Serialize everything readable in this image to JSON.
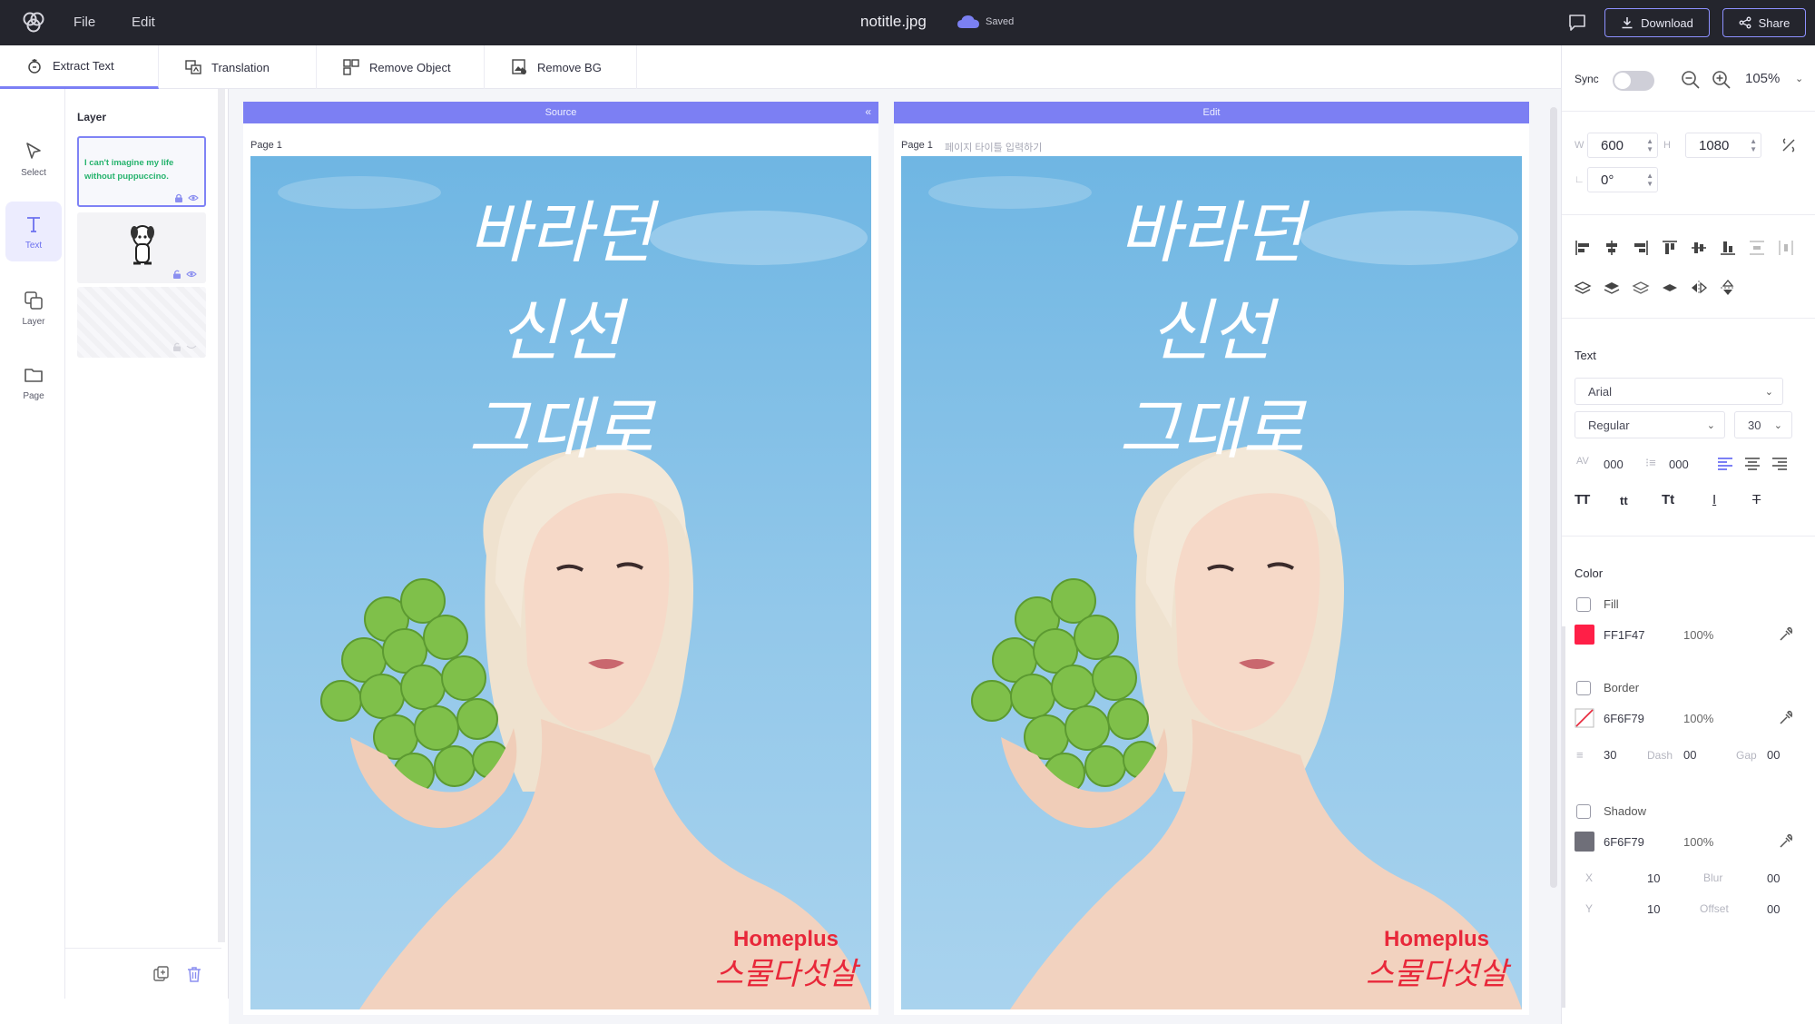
{
  "topbar": {
    "menu": [
      "File",
      "Edit"
    ],
    "file_name": "notitle.jpg",
    "save_status": "Saved",
    "download_label": "Download",
    "share_label": "Share"
  },
  "tools": {
    "tabs": [
      "Extract Text",
      "Translation",
      "Remove Object",
      "Remove BG"
    ]
  },
  "rail": {
    "items": [
      "Select",
      "Text",
      "Layer",
      "Page"
    ]
  },
  "layer_panel": {
    "title": "Layer",
    "layers": [
      {
        "text": "I can't imagine my life without puppuccino."
      }
    ]
  },
  "canvas": {
    "source_header": "Source",
    "edit_header": "Edit",
    "source_page_label": "Page 1",
    "edit_page_label": "Page 1",
    "edit_page_title_placeholder": "페이지 타이틀 입력하기",
    "poster": {
      "headline_lines": [
        "바라던",
        "신선",
        "그대로"
      ],
      "brand": "Homeplus",
      "brand_sub": "스물다섯살"
    }
  },
  "props": {
    "sync_label": "Sync",
    "sync_on": false,
    "zoom": "105%",
    "width_label": "W",
    "width": "600",
    "height_label": "H",
    "height": "1080",
    "rotation": "0°",
    "text_section": "Text",
    "font_family": "Arial",
    "font_weight": "Regular",
    "font_size": "30",
    "letter_spacing": "000",
    "line_height": "000",
    "color_section": "Color",
    "fill_label": "Fill",
    "fill_hex": "FF1F47",
    "fill_opacity": "100%",
    "fill_color": "#ff1f47",
    "border_label": "Border",
    "border_hex": "6F6F79",
    "border_opacity": "100%",
    "border_width": "30",
    "dash_label": "Dash",
    "dash_value": "00",
    "gap_label": "Gap",
    "gap_value": "00",
    "shadow_label": "Shadow",
    "shadow_hex": "6F6F79",
    "shadow_opacity": "100%",
    "shadow_color": "#6f6f79",
    "shadow_x_label": "X",
    "shadow_x": "10",
    "blur_label": "Blur",
    "blur_value": "00",
    "shadow_y_label": "Y",
    "shadow_y": "10",
    "offset_label": "Offset",
    "offset_value": "00"
  },
  "colors": {
    "accent": "#7c7ff3",
    "topbar_bg": "#24252d",
    "brand_red": "#e8283a"
  }
}
